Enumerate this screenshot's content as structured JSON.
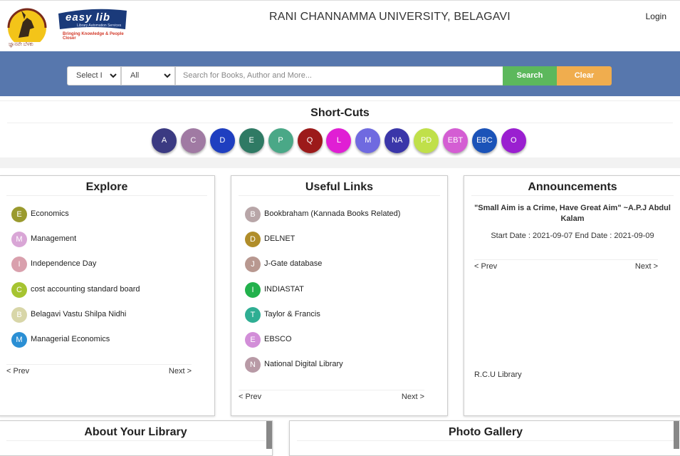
{
  "header": {
    "university_title": "RANI CHANNAMMA UNIVERSITY, BELAGAVI",
    "login_label": "Login",
    "logo_caption": "ಜ್ಞಾನವೇ ಬೆಳಕು",
    "easylib_brand": "easy lib",
    "easylib_sub": "Library Automation Services",
    "easylib_tagline": "Bringing Knowledge & People Closer"
  },
  "search": {
    "select_type": "Select I",
    "select_scope": "All",
    "placeholder": "Search for Books, Author and More...",
    "search_label": "Search",
    "clear_label": "Clear"
  },
  "shortcuts": {
    "title": "Short-Cuts",
    "items": [
      {
        "label": "A",
        "color": "#3b3a82"
      },
      {
        "label": "C",
        "color": "#a07aa3"
      },
      {
        "label": "D",
        "color": "#1f3fc0"
      },
      {
        "label": "E",
        "color": "#2f7a64"
      },
      {
        "label": "P",
        "color": "#4aa887"
      },
      {
        "label": "Q",
        "color": "#9c1a1a"
      },
      {
        "label": "L",
        "color": "#e01fd4"
      },
      {
        "label": "M",
        "color": "#6f6ae0"
      },
      {
        "label": "NA",
        "color": "#3a36a9"
      },
      {
        "label": "PD",
        "color": "#c0e04a"
      },
      {
        "label": "EBT",
        "color": "#d45ed3"
      },
      {
        "label": "EBC",
        "color": "#1b53b8"
      },
      {
        "label": "O",
        "color": "#9a1fd0"
      }
    ]
  },
  "explore": {
    "title": "Explore",
    "items": [
      {
        "letter": "E",
        "label": "Economics",
        "color": "#9a9a2e"
      },
      {
        "letter": "M",
        "label": "Management",
        "color": "#d9a6d6"
      },
      {
        "letter": "I",
        "label": "Independence Day",
        "color": "#d9a0ad"
      },
      {
        "letter": "C",
        "label": "cost accounting standard board",
        "color": "#a6c431"
      },
      {
        "letter": "B",
        "label": "Belagavi Vastu Shilpa Nidhi",
        "color": "#d8d6a8"
      },
      {
        "letter": "M",
        "label": "Managerial Economics",
        "color": "#2b8fd4"
      }
    ],
    "prev": "< Prev",
    "next": "Next >"
  },
  "useful_links": {
    "title": "Useful Links",
    "items": [
      {
        "letter": "B",
        "label": "Bookbraham (Kannada Books Related)",
        "color": "#b8a6a8"
      },
      {
        "letter": "D",
        "label": "DELNET",
        "color": "#b08d2a"
      },
      {
        "letter": "J",
        "label": "J-Gate database",
        "color": "#b89890"
      },
      {
        "letter": "I",
        "label": "INDIASTAT",
        "color": "#22b14c"
      },
      {
        "letter": "T",
        "label": "Taylor & Francis",
        "color": "#2fae93"
      },
      {
        "letter": "E",
        "label": "EBSCO",
        "color": "#d28ed8"
      },
      {
        "letter": "N",
        "label": "National Digital Library",
        "color": "#b89aa6"
      }
    ],
    "prev": "< Prev",
    "next": "Next >"
  },
  "announcements": {
    "title": "Announcements",
    "quote": "\"Small Aim is a Crime, Have Great Aim\" ~A.P.J Abdul Kalam",
    "dates": "Start Date : 2021-09-07 End Date : 2021-09-09",
    "prev": "< Prev",
    "next": "Next >",
    "footer": "R.C.U Library"
  },
  "bottom": {
    "about_title": "About Your Library",
    "gallery_title": "Photo Gallery"
  }
}
